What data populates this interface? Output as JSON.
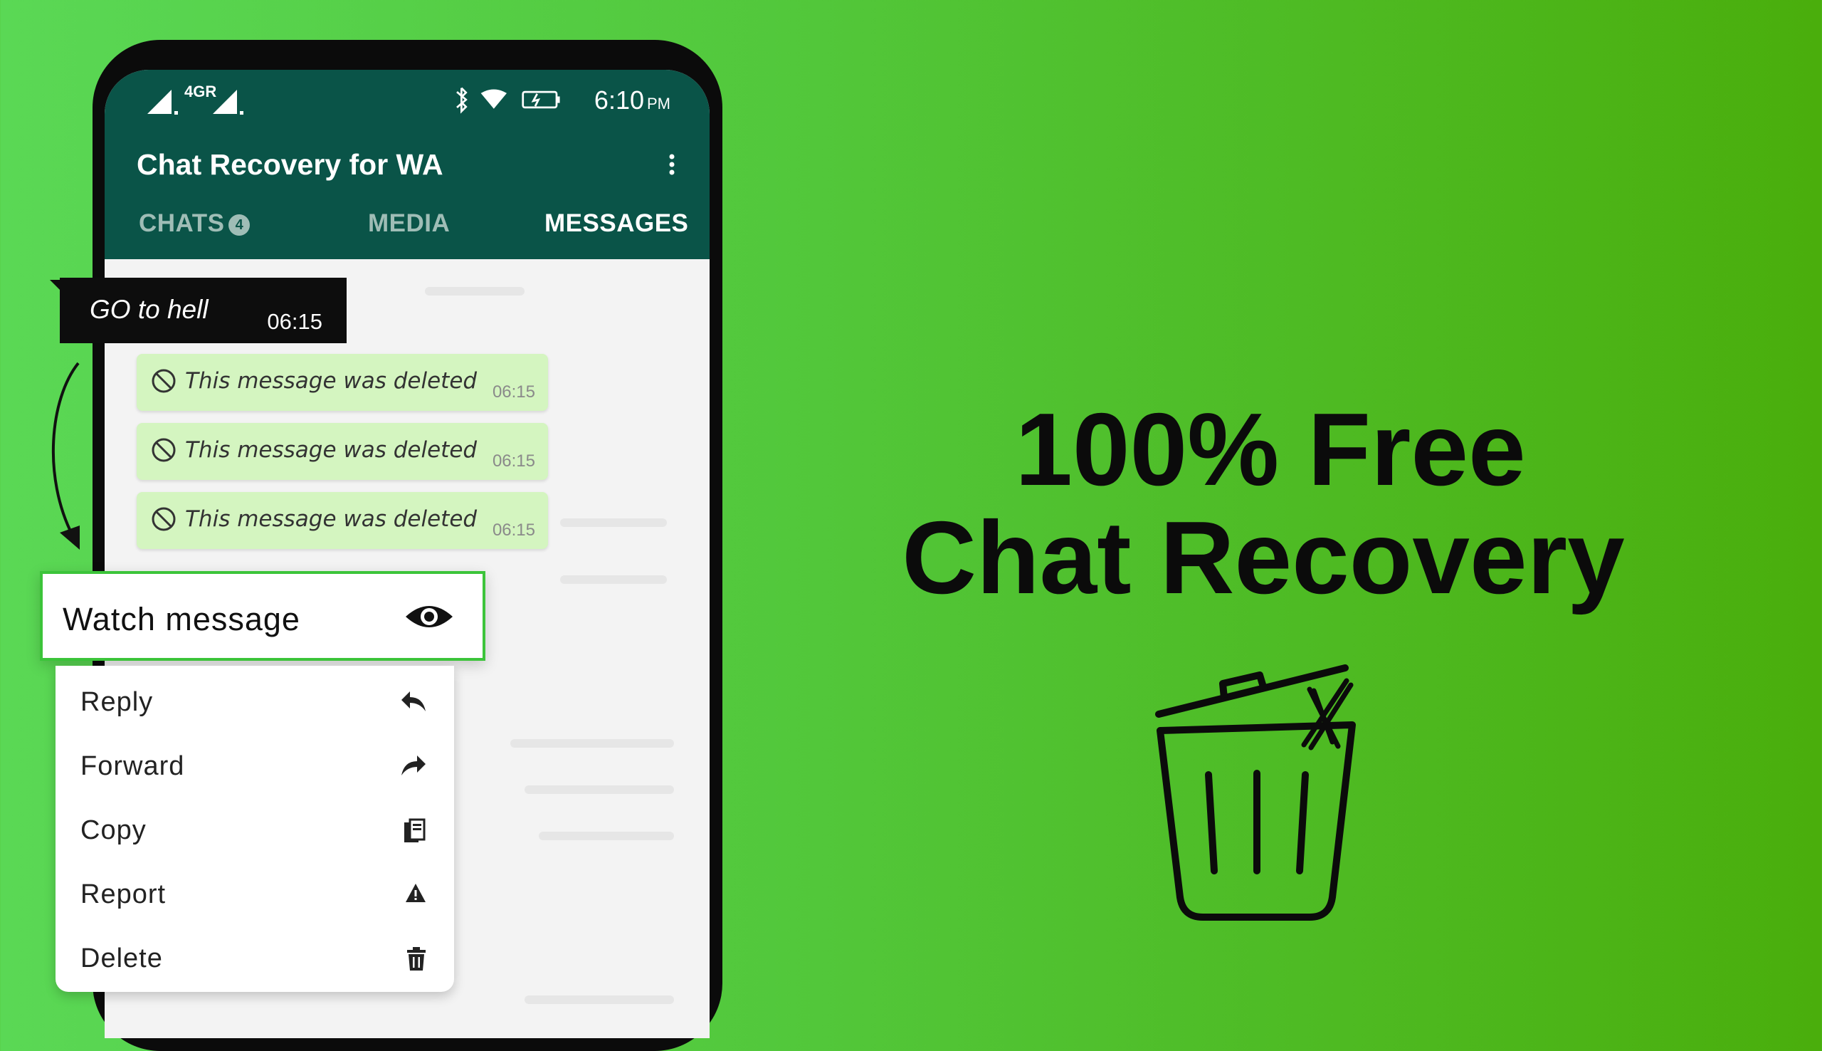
{
  "status_bar": {
    "network": "4GR",
    "time": "6:10",
    "ampm": "PM"
  },
  "app": {
    "title": "Chat Recovery for WA",
    "tabs": [
      {
        "label": "CHATS",
        "badge": "4"
      },
      {
        "label": "MEDIA"
      },
      {
        "label": "MESSAGES"
      }
    ]
  },
  "recovered_message": {
    "text": "GO to hell",
    "time": "06:15"
  },
  "deleted_messages": [
    {
      "text": "This message was deleted",
      "time": "06:15"
    },
    {
      "text": "This message was deleted",
      "time": "06:15"
    },
    {
      "text": "This message was deleted",
      "time": "06:15"
    }
  ],
  "watch": {
    "label": "Watch message",
    "icon": "eye-icon"
  },
  "context_menu": [
    {
      "label": "Reply",
      "icon": "reply-icon"
    },
    {
      "label": "Forward",
      "icon": "forward-icon"
    },
    {
      "label": "Copy",
      "icon": "copy-icon"
    },
    {
      "label": "Report",
      "icon": "warning-icon"
    },
    {
      "label": "Delete",
      "icon": "trash-icon"
    }
  ],
  "headline": {
    "line1": "100% Free",
    "line2": "Chat Recovery"
  },
  "colors": {
    "background_start": "#5ad855",
    "background_end": "#4aae0c",
    "appbar": "#0a5448",
    "bubble": "#d4f5c0",
    "watch_border": "#3cc43a"
  }
}
